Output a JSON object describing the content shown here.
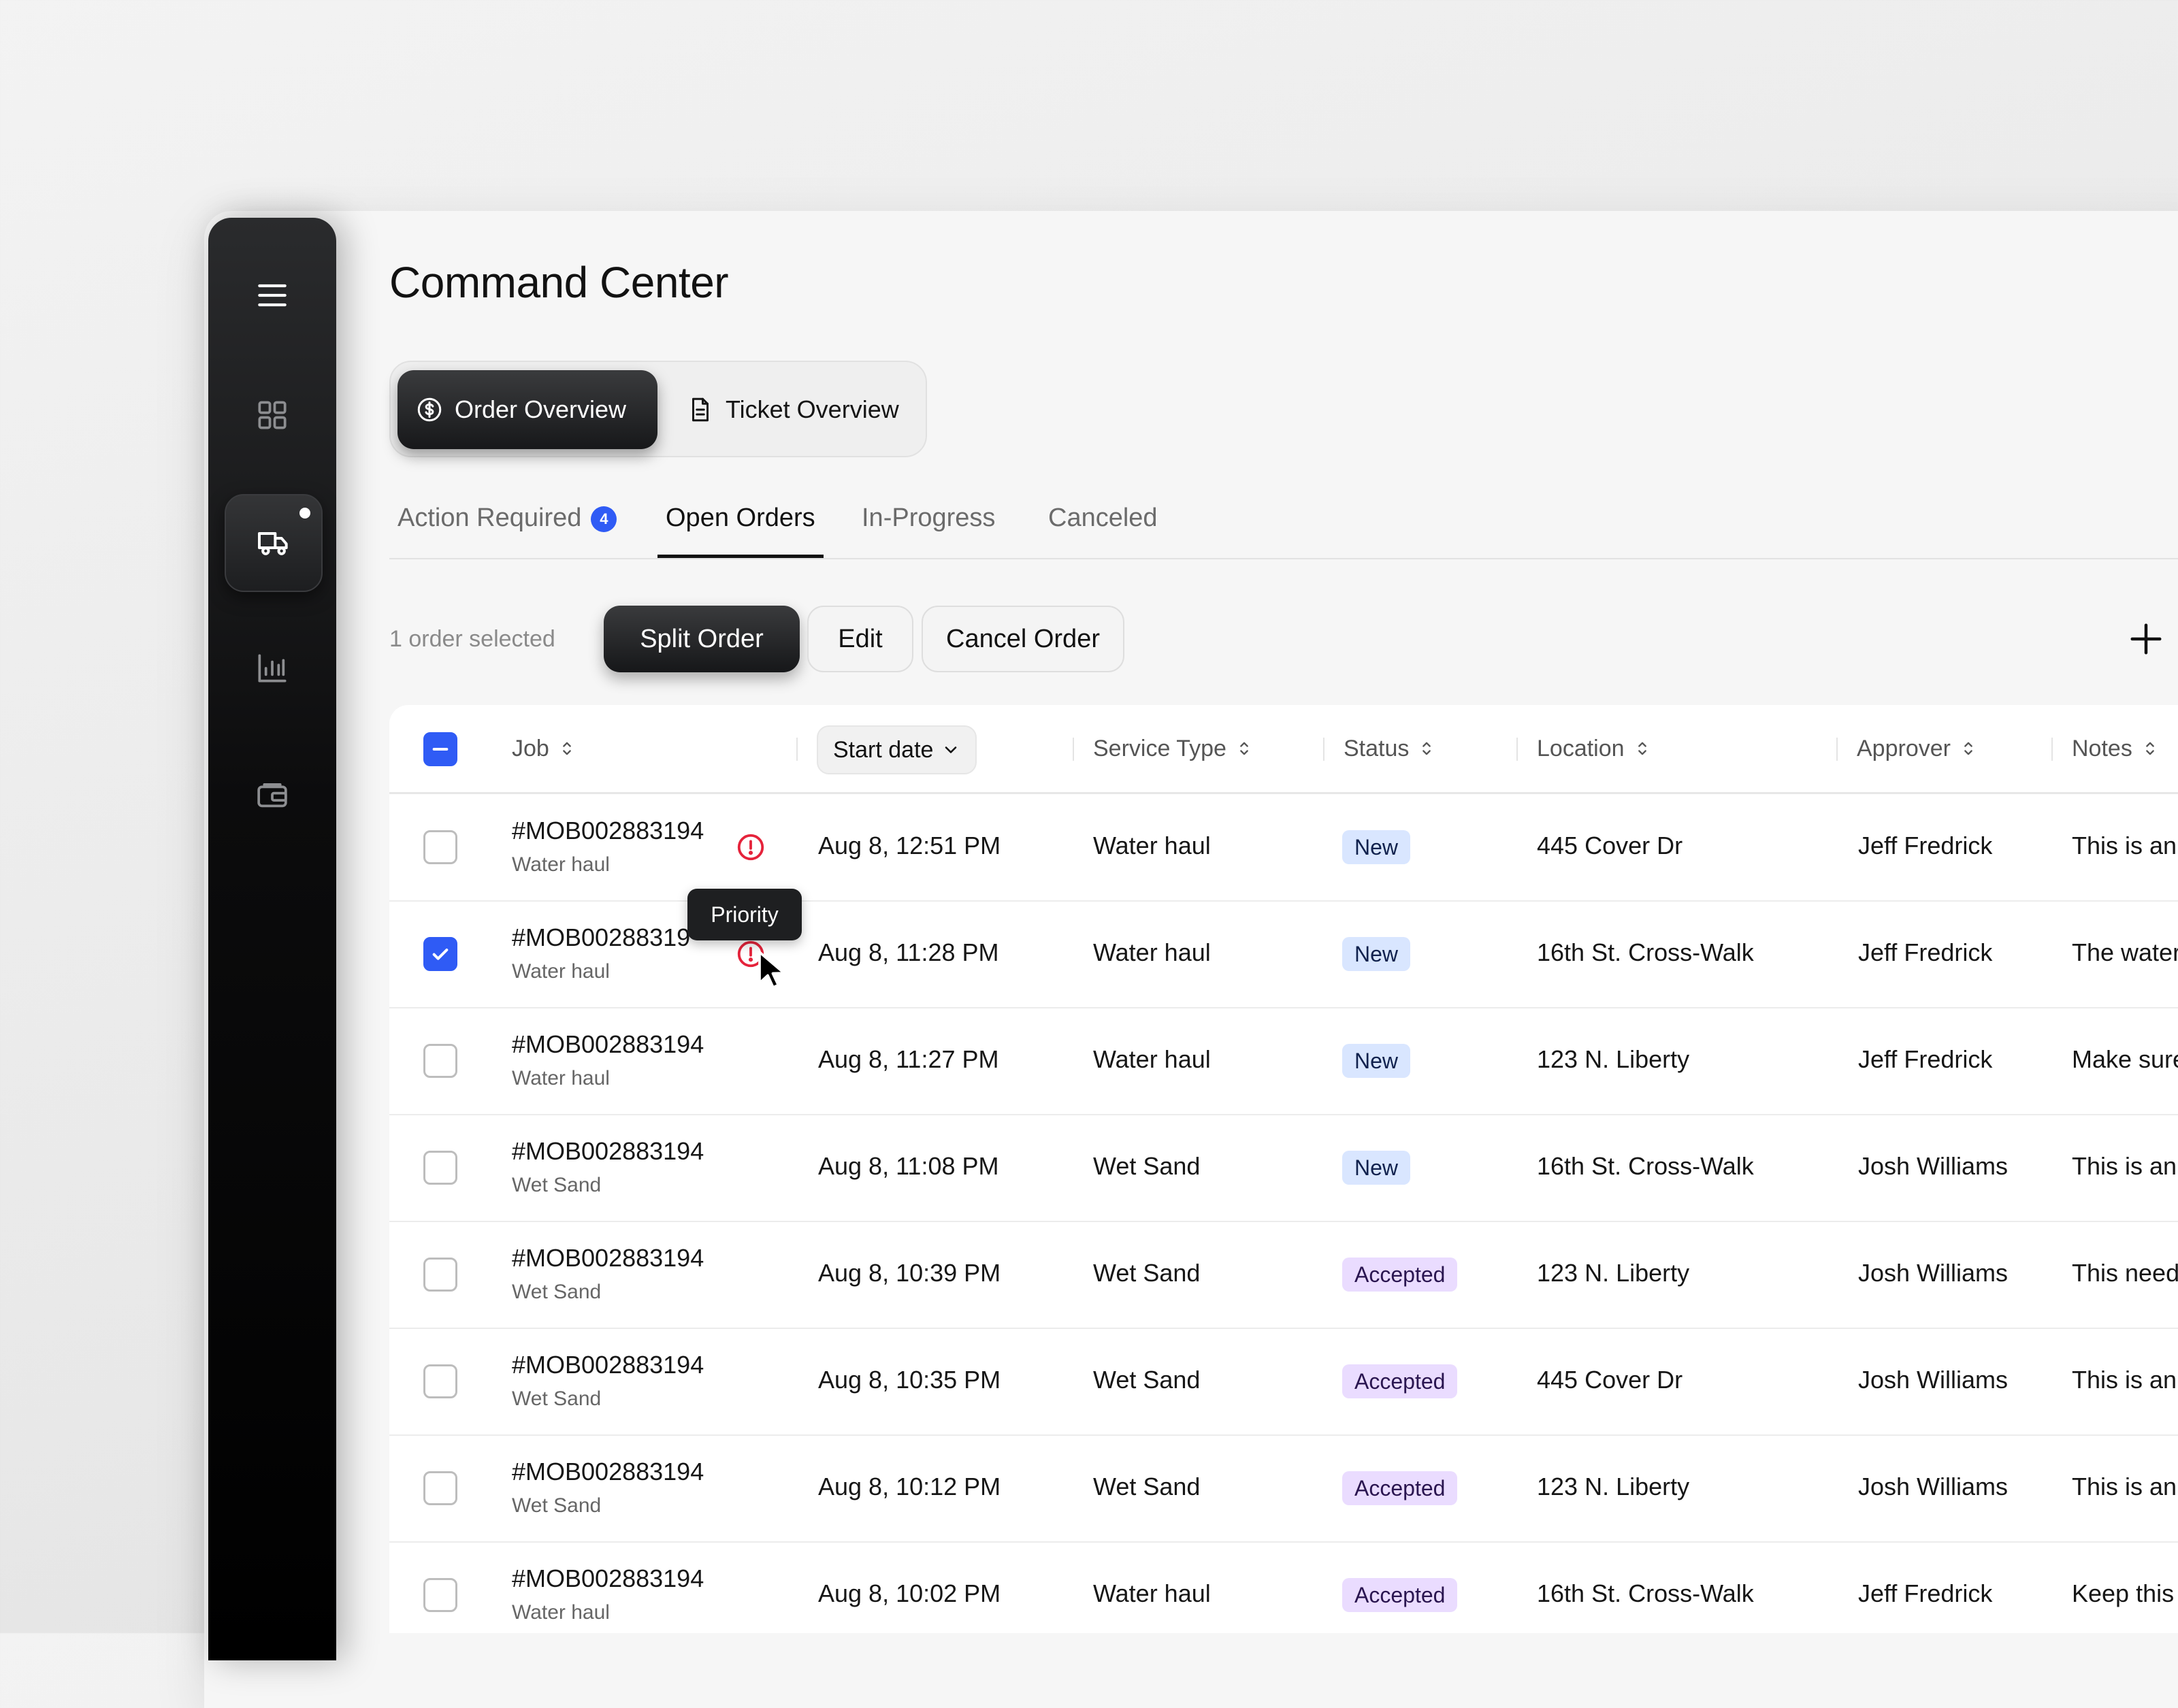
{
  "page": {
    "title": "Command Center"
  },
  "view_toggle": {
    "order_overview": "Order Overview",
    "ticket_overview": "Ticket Overview"
  },
  "tabs": [
    {
      "label": "Action Required",
      "badge": "4"
    },
    {
      "label": "Open Orders",
      "active": true
    },
    {
      "label": "In-Progress"
    },
    {
      "label": "Canceled"
    }
  ],
  "toolbar": {
    "selection_text": "1 order selected",
    "split_order": "Split Order",
    "edit": "Edit",
    "cancel_order": "Cancel Order"
  },
  "table": {
    "headers": {
      "job": "Job",
      "start_date": "Start date",
      "service_type": "Service Type",
      "status": "Status",
      "location": "Location",
      "approver": "Approver",
      "notes": "Notes"
    },
    "rows": [
      {
        "job": "#MOB002883194",
        "sub": "Water haul",
        "priority": true,
        "start": "Aug 8, 12:51 PM",
        "service": "Water haul",
        "status": "New",
        "location": "445 Cover Dr",
        "approver": "Jeff Fredrick",
        "notes": "This is an",
        "checked": false
      },
      {
        "job": "#MOB00288319",
        "sub": "Water haul",
        "priority": true,
        "start": "Aug 8, 11:28 PM",
        "service": "Water haul",
        "status": "New",
        "location": "16th St. Cross-Walk",
        "approver": "Jeff Fredrick",
        "notes": "The water",
        "checked": true
      },
      {
        "job": "#MOB002883194",
        "sub": "Water haul",
        "priority": false,
        "start": "Aug 8, 11:27 PM",
        "service": "Water haul",
        "status": "New",
        "location": "123 N. Liberty",
        "approver": "Jeff Fredrick",
        "notes": "Make sure",
        "checked": false
      },
      {
        "job": "#MOB002883194",
        "sub": "Wet Sand",
        "priority": false,
        "start": "Aug 8, 11:08 PM",
        "service": "Wet Sand",
        "status": "New",
        "location": "16th St. Cross-Walk",
        "approver": "Josh Williams",
        "notes": "This is an",
        "checked": false
      },
      {
        "job": "#MOB002883194",
        "sub": "Wet Sand",
        "priority": false,
        "start": "Aug 8, 10:39 PM",
        "service": "Wet Sand",
        "status": "Accepted",
        "location": "123 N. Liberty",
        "approver": "Josh Williams",
        "notes": "This need",
        "checked": false
      },
      {
        "job": "#MOB002883194",
        "sub": "Wet Sand",
        "priority": false,
        "start": "Aug 8, 10:35 PM",
        "service": "Wet Sand",
        "status": "Accepted",
        "location": "445 Cover Dr",
        "approver": "Josh Williams",
        "notes": "This is an",
        "checked": false
      },
      {
        "job": "#MOB002883194",
        "sub": "Wet Sand",
        "priority": false,
        "start": "Aug 8, 10:12 PM",
        "service": "Wet Sand",
        "status": "Accepted",
        "location": "123 N. Liberty",
        "approver": "Josh Williams",
        "notes": "This is an",
        "checked": false
      },
      {
        "job": "#MOB002883194",
        "sub": "Water haul",
        "priority": false,
        "start": "Aug 8, 10:02 PM",
        "service": "Water haul",
        "status": "Accepted",
        "location": "16th St. Cross-Walk",
        "approver": "Jeff Fredrick",
        "notes": "Keep this",
        "checked": false
      }
    ]
  },
  "tooltip": {
    "text": "Priority"
  },
  "colors": {
    "accent": "#2f5bf5",
    "priority": "#e5233b",
    "badge_new": "#d9e6ff",
    "badge_accepted": "#eadcff"
  }
}
